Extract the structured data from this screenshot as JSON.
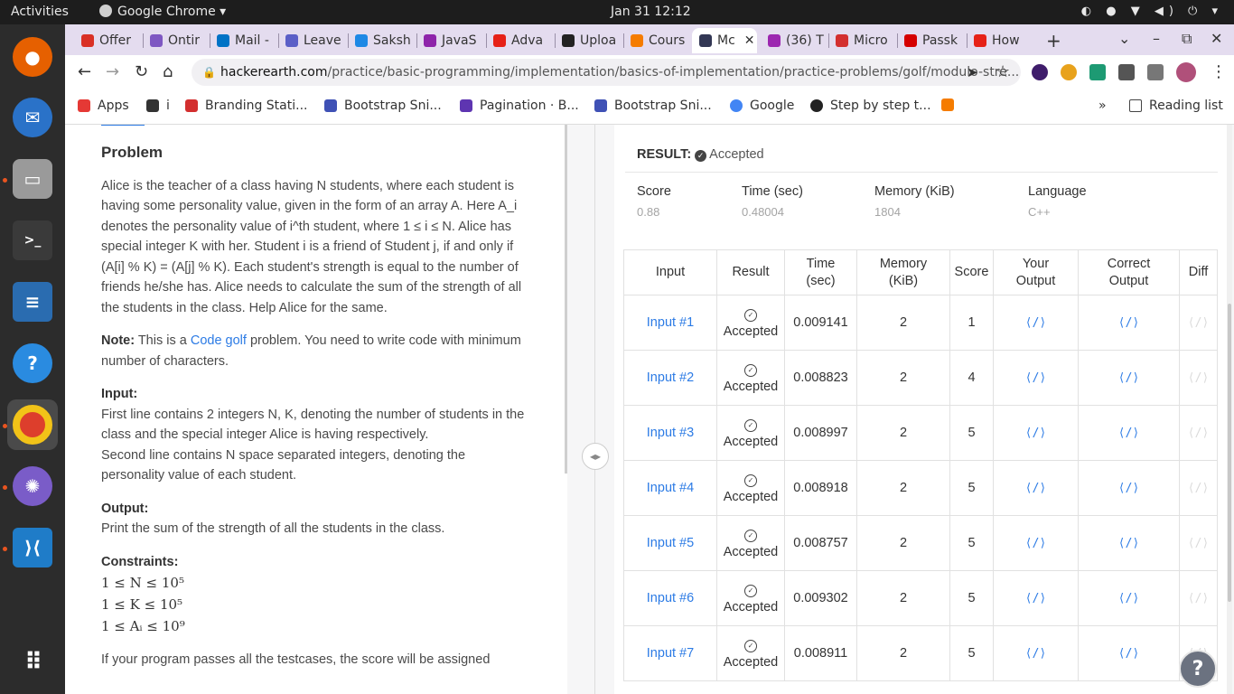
{
  "system_bar": {
    "activities": "Activities",
    "app_name": "Google Chrome ▾",
    "clock": "Jan 31  12:12",
    "tray": "◐ ● ▼ ◀) ⏻ ▾"
  },
  "dock": {
    "items": [
      "firefox-icon",
      "thunderbird-icon",
      "files-icon",
      "terminal-icon",
      "writer-icon",
      "help-icon",
      "chrome-icon",
      "network-icon",
      "vscode-icon",
      "app-grid-icon"
    ]
  },
  "tabs": [
    {
      "label": "Offer",
      "color": "#d93025"
    },
    {
      "label": "Ontir",
      "color": "#7e57c2"
    },
    {
      "label": "Mail -",
      "color": "#0072c6"
    },
    {
      "label": "Leave",
      "color": "#5b5fc7"
    },
    {
      "label": "Saksh",
      "color": "#1e88e5"
    },
    {
      "label": "JavaS",
      "color": "#8e24aa"
    },
    {
      "label": "Adva",
      "color": "#e62117"
    },
    {
      "label": "Uploa",
      "color": "#222222"
    },
    {
      "label": "Cours",
      "color": "#f57c00"
    },
    {
      "label": "Mc",
      "color": "#323754",
      "active": true,
      "close": "✕"
    },
    {
      "label": "(36) T",
      "color": "#9c27b0"
    },
    {
      "label": "Micro",
      "color": "#d32f2f"
    },
    {
      "label": "Passk",
      "color": "#d50000"
    },
    {
      "label": "How",
      "color": "#e62117"
    }
  ],
  "tabbar": {
    "new_tab": "+",
    "tab_search": "⌄",
    "minimize": "–",
    "restore": "⧉",
    "close": "✕"
  },
  "address": {
    "host": "hackerearth.com",
    "path": "/practice/basic-programming/implementation/basics-of-implementation/practice-problems/golf/modulo-stre..."
  },
  "nav": {
    "back": "←",
    "forward": "→",
    "reload": "↻",
    "home": "⌂",
    "send": "➤",
    "star": "☆",
    "menu": "⋮"
  },
  "bookmarks": [
    {
      "label": "Apps",
      "color": "#e53935"
    },
    {
      "label": "i",
      "color": "#333333"
    },
    {
      "label": "Branding Stati...",
      "color": "#d32f2f"
    },
    {
      "label": "Bootstrap Sni...",
      "color": "#3f51b5"
    },
    {
      "label": "Pagination · B...",
      "color": "#5e35b1"
    },
    {
      "label": "Bootstrap Sni...",
      "color": "#3f51b5"
    },
    {
      "label": "Google",
      "color": "#4285f4"
    },
    {
      "label": "Step by step t...",
      "color": "#222222"
    },
    {
      "label": "",
      "color": "#f57c00"
    }
  ],
  "bookmarks_more": "»",
  "reading_list": "Reading list",
  "problem": {
    "title": "Problem",
    "p1": "Alice is the teacher of a class having N students, where each student is having some personality value, given in the form of an array A. Here A_i denotes the personality value of i^th student, where 1 ≤ i ≤ N. Alice has special integer K with her. Student i is a friend of Student j, if and only if (A[i] % K) = (A[j] % K). Each student's strength is equal to the number of friends he/she has. Alice needs to calculate the sum of the strength of all the students in the class. Help Alice for the same.",
    "note_label": "Note:",
    "note_pre": " This is a ",
    "note_link": "Code golf",
    "note_post": " problem. You need to write code with minimum number of characters.",
    "input_label": "Input:",
    "input_text1": "First line contains 2 integers N, K, denoting the number of students in the class and the special integer Alice is having respectively.",
    "input_text2": "Second line contains N space separated integers, denoting the personality value of each student.",
    "output_label": "Output:",
    "output_text": "Print the sum of the strength of all the students in the class.",
    "constraints_label": "Constraints:",
    "constraints": [
      "1 ≤ N ≤ 10⁵",
      "1 ≤ K ≤ 10⁵",
      "1 ≤ Aᵢ ≤ 10⁹"
    ],
    "footer": "If your program passes all the testcases, the score will be assigned"
  },
  "result": {
    "label": "RESULT:",
    "status": "Accepted",
    "stats": [
      {
        "key": "Score",
        "value": "0.88"
      },
      {
        "key": "Time (sec)",
        "value": "0.48004"
      },
      {
        "key": "Memory (KiB)",
        "value": "1804"
      },
      {
        "key": "Language",
        "value": "C++"
      }
    ]
  },
  "table": {
    "headers": [
      "Input",
      "Result",
      "Time (sec)",
      "Memory (KiB)",
      "Score",
      "Your Output",
      "Correct Output",
      "Diff"
    ],
    "rows": [
      {
        "input": "Input #1",
        "result": "Accepted",
        "time": "0.009141",
        "memory": "2",
        "score": "1"
      },
      {
        "input": "Input #2",
        "result": "Accepted",
        "time": "0.008823",
        "memory": "2",
        "score": "4"
      },
      {
        "input": "Input #3",
        "result": "Accepted",
        "time": "0.008997",
        "memory": "2",
        "score": "5"
      },
      {
        "input": "Input #4",
        "result": "Accepted",
        "time": "0.008918",
        "memory": "2",
        "score": "5"
      },
      {
        "input": "Input #5",
        "result": "Accepted",
        "time": "0.008757",
        "memory": "2",
        "score": "5"
      },
      {
        "input": "Input #6",
        "result": "Accepted",
        "time": "0.009302",
        "memory": "2",
        "score": "5"
      },
      {
        "input": "Input #7",
        "result": "Accepted",
        "time": "0.008911",
        "memory": "2",
        "score": "5"
      }
    ]
  },
  "help": "?"
}
